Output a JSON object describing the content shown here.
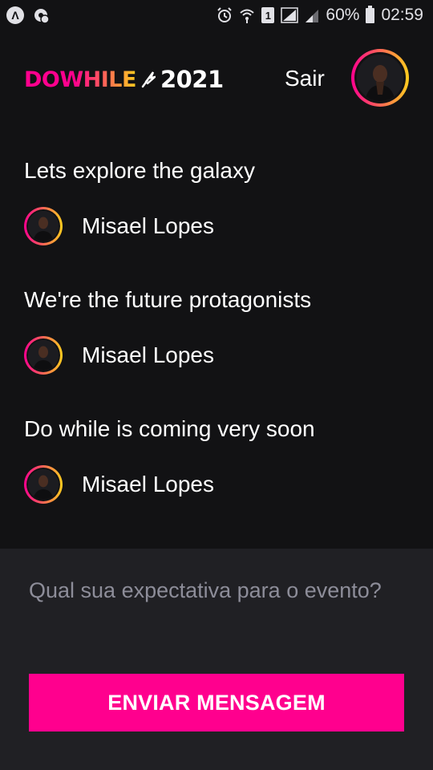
{
  "status_bar": {
    "battery_percent": "60%",
    "time": "02:59",
    "sim_slot": "1",
    "left_icons": [
      "launcher-icon",
      "settings-gear-icon"
    ],
    "right_icons": [
      "alarm-icon",
      "wifi-icon",
      "sim-icon",
      "signal-icon",
      "signal-icon",
      "battery-icon"
    ]
  },
  "header": {
    "logo_word": "DOWHILE",
    "logo_year": "2021",
    "signout_label": "Sair",
    "avatar_icon": "user-avatar"
  },
  "messages": [
    {
      "text": "Lets explore the galaxy",
      "user": "Misael Lopes"
    },
    {
      "text": "We're the future protagonists",
      "user": "Misael Lopes"
    },
    {
      "text": "Do while is coming very soon",
      "user": "Misael Lopes"
    }
  ],
  "composer": {
    "placeholder": "Qual sua expectativa para o evento?",
    "value": "",
    "send_label": "ENVIAR MENSAGEM"
  },
  "colors": {
    "background": "#121214",
    "composer_bg": "#202024",
    "accent_pink": "#ff008e",
    "accent_yellow": "#ffcd1e",
    "text": "#ffffff",
    "placeholder": "#8d8d99"
  }
}
